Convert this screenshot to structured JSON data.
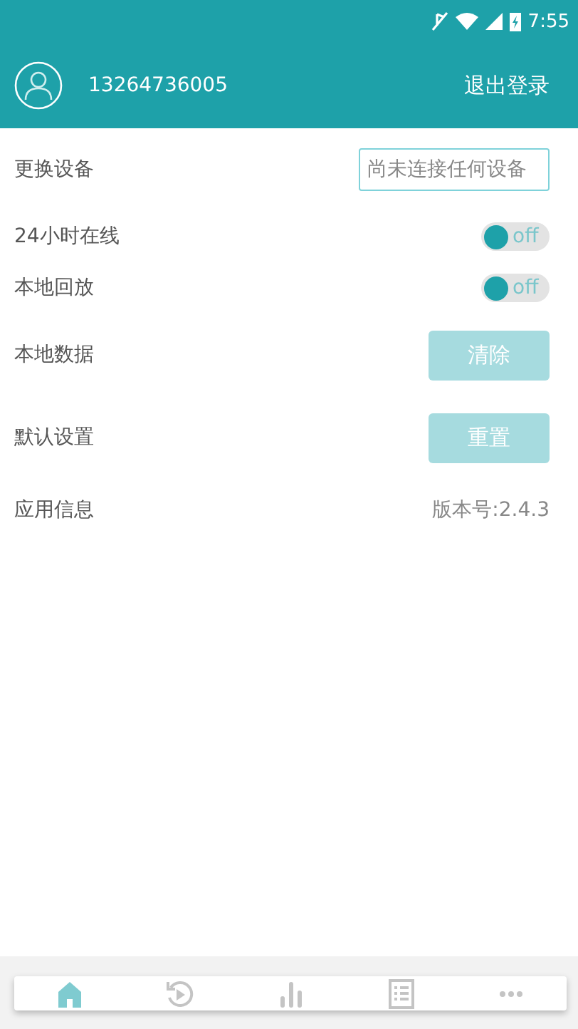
{
  "status_bar": {
    "time": "7:55"
  },
  "header": {
    "phone": "13264736005",
    "logout": "退出登录"
  },
  "settings": [
    {
      "kind": "field",
      "label": "更换设备",
      "placeholder": "尚未连接任何设备"
    },
    {
      "kind": "toggle",
      "label": "24小时在线",
      "on": false,
      "state_text": "off"
    },
    {
      "kind": "toggle",
      "label": "本地回放",
      "on": false,
      "state_text": "off"
    },
    {
      "kind": "button",
      "label": "本地数据",
      "button": "清除"
    },
    {
      "kind": "button",
      "label": "默认设置",
      "button": "重置"
    },
    {
      "kind": "info",
      "label": "应用信息",
      "value": "版本号:2.4.3"
    }
  ],
  "bottom_nav": [
    {
      "kind": "home",
      "selected": true
    },
    {
      "kind": "replay",
      "selected": false
    },
    {
      "kind": "chart",
      "selected": false
    },
    {
      "kind": "list",
      "selected": false
    },
    {
      "kind": "more",
      "selected": false
    }
  ]
}
